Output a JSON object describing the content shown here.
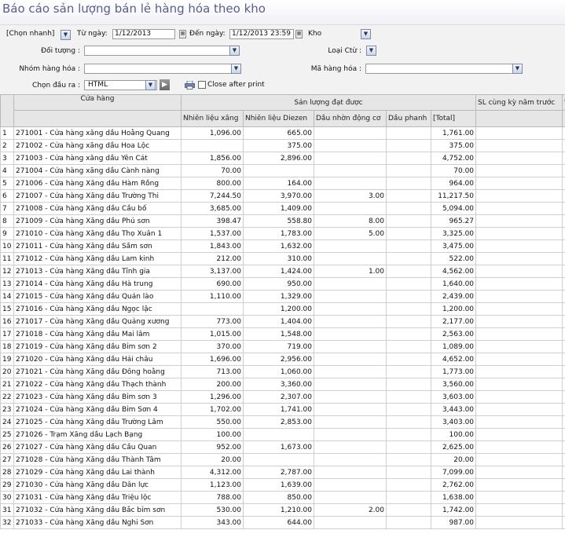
{
  "title": "Báo cáo sản lượng bán lẻ hàng hóa theo kho",
  "filters": {
    "quick_select": "[Chọn nhanh]",
    "from_label": "Từ ngày:",
    "from_value": "1/12/2013",
    "to_label": "Đến ngày:",
    "to_value": "1/12/2013 23:59",
    "warehouse_label": "Kho",
    "object_label": "Đối tượng :",
    "type_label": "Loại Ctừ :",
    "group_label": "Nhóm hàng hóa :",
    "code_label": "Mã hàng hóa :",
    "output_label": "Chọn đầu ra :",
    "output_value": "HTML",
    "close_after_print": "Close after print"
  },
  "table": {
    "header_store": "Cửa hàng",
    "header_group": "Sản lượng đạt được",
    "header_prev": "SL cùng kỳ năm trước",
    "header_pct": "%",
    "sub_headers": [
      "Nhiên liệu xăng",
      "Nhiên liệu Diezen",
      "Dầu nhờn động cơ",
      "Dầu phanh",
      "[Total]"
    ],
    "rows": [
      [
        "1",
        "271001 - Cửa hàng xăng dầu Hoằng Quang",
        "1,096.00",
        "665.00",
        "",
        "",
        "1,761.00"
      ],
      [
        "2",
        "271002 - Cửa hàng xăng dầu Hoa Lộc",
        "",
        "375.00",
        "",
        "",
        "375.00"
      ],
      [
        "3",
        "271003 - Cửa hàng xăng dầu Yên Cát",
        "1,856.00",
        "2,896.00",
        "",
        "",
        "4,752.00"
      ],
      [
        "4",
        "271004 - Cửa hàng xăng dầu Cành nàng",
        "70.00",
        "",
        "",
        "",
        "70.00"
      ],
      [
        "5",
        "271006 - Cửa hàng Xăng dầu Hàm Rồng",
        "800.00",
        "164.00",
        "",
        "",
        "964.00"
      ],
      [
        "6",
        "271007 - Cửa hàng Xăng dầu Trường Thi",
        "7,244.50",
        "3,970.00",
        "3.00",
        "",
        "11,217.50"
      ],
      [
        "7",
        "271008 - Cửa hàng Xăng dầu Cầu bố",
        "3,685.00",
        "1,409.00",
        "",
        "",
        "5,094.00"
      ],
      [
        "8",
        "271009 - Cửa hàng Xăng dầu Phú sơn",
        "398.47",
        "558.80",
        "8.00",
        "",
        "965.27"
      ],
      [
        "9",
        "271010 - Cửa hàng Xăng dầu Thọ Xuân 1",
        "1,537.00",
        "1,783.00",
        "5.00",
        "",
        "3,325.00"
      ],
      [
        "10",
        "271011 - Cửa hàng Xăng dầu Sầm sơn",
        "1,843.00",
        "1,632.00",
        "",
        "",
        "3,475.00"
      ],
      [
        "11",
        "271012 - Cửa hàng Xăng dầu Lam kinh",
        "212.00",
        "310.00",
        "",
        "",
        "522.00"
      ],
      [
        "12",
        "271013 - Cửa hàng Xăng dầu Tĩnh gia",
        "3,137.00",
        "1,424.00",
        "1.00",
        "",
        "4,562.00"
      ],
      [
        "13",
        "271014 - Cửa hàng Xăng dầu Hà trung",
        "690.00",
        "950.00",
        "",
        "",
        "1,640.00"
      ],
      [
        "14",
        "271015 - Cửa hàng Xăng dầu Quán lào",
        "1,110.00",
        "1,329.00",
        "",
        "",
        "2,439.00"
      ],
      [
        "15",
        "271016 - Cửa hàng Xăng dầu Ngọc lặc",
        "",
        "1,200.00",
        "",
        "",
        "1,200.00"
      ],
      [
        "16",
        "271017 - Cửa hàng Xăng dầu Quảng xương",
        "773.00",
        "1,404.00",
        "",
        "",
        "2,177.00"
      ],
      [
        "17",
        "271018 - Cửa hàng Xăng dầu Mai lâm",
        "1,015.00",
        "1,548.00",
        "",
        "",
        "2,563.00"
      ],
      [
        "18",
        "271019 - Cửa hàng Xăng dầu Bỉm sơn 2",
        "370.00",
        "719.00",
        "",
        "",
        "1,089.00"
      ],
      [
        "19",
        "271020 - Cửa hàng Xăng dầu Hải châu",
        "1,696.00",
        "2,956.00",
        "",
        "",
        "4,652.00"
      ],
      [
        "20",
        "271021 - Cửa hàng Xăng dầu Đông hoằng",
        "713.00",
        "1,060.00",
        "",
        "",
        "1,773.00"
      ],
      [
        "21",
        "271022 - Cửa hàng Xăng dầu Thạch thành",
        "200.00",
        "3,360.00",
        "",
        "",
        "3,560.00"
      ],
      [
        "22",
        "271023 - Cửa hàng Xăng dầu Bỉm sơn 3",
        "1,296.00",
        "2,307.00",
        "",
        "",
        "3,603.00"
      ],
      [
        "23",
        "271024 - Cửa hàng Xăng dầu Bỉm Sơn 4",
        "1,702.00",
        "1,741.00",
        "",
        "",
        "3,443.00"
      ],
      [
        "24",
        "271025 - Cửa hàng Xăng dầu Trường Lâm",
        "550.00",
        "2,853.00",
        "",
        "",
        "3,403.00"
      ],
      [
        "25",
        "271026 - Trạm Xăng dầu Lạch Bạng",
        "100.00",
        "",
        "",
        "",
        "100.00"
      ],
      [
        "26",
        "271027 - Cửa hàng Xăng dầu Cầu Quan",
        "952.00",
        "1,673.00",
        "",
        "",
        "2,625.00"
      ],
      [
        "27",
        "271028 - Cửa hàng Xăng dầu Thành Tâm",
        "20.00",
        "",
        "",
        "",
        "20.00"
      ],
      [
        "28",
        "271029 - Cửa hàng Xăng dầu Lai thành",
        "4,312.00",
        "2,787.00",
        "",
        "",
        "7,099.00"
      ],
      [
        "29",
        "271030 - Cửa hàng Xăng dầu Dân lực",
        "1,123.00",
        "1,639.00",
        "",
        "",
        "2,762.00"
      ],
      [
        "30",
        "271031 - Cửa hàng Xăng dầu Triệu lộc",
        "788.00",
        "850.00",
        "",
        "",
        "1,638.00"
      ],
      [
        "31",
        "271032 - Cửa hàng Xăng dầu Bắc bỉm sơn",
        "530.00",
        "1,210.00",
        "2.00",
        "",
        "1,742.00"
      ],
      [
        "32",
        "271033 - Cửa hàng Xăng dầu Nghi Sơn",
        "343.00",
        "644.00",
        "",
        "",
        "987.00"
      ]
    ]
  }
}
